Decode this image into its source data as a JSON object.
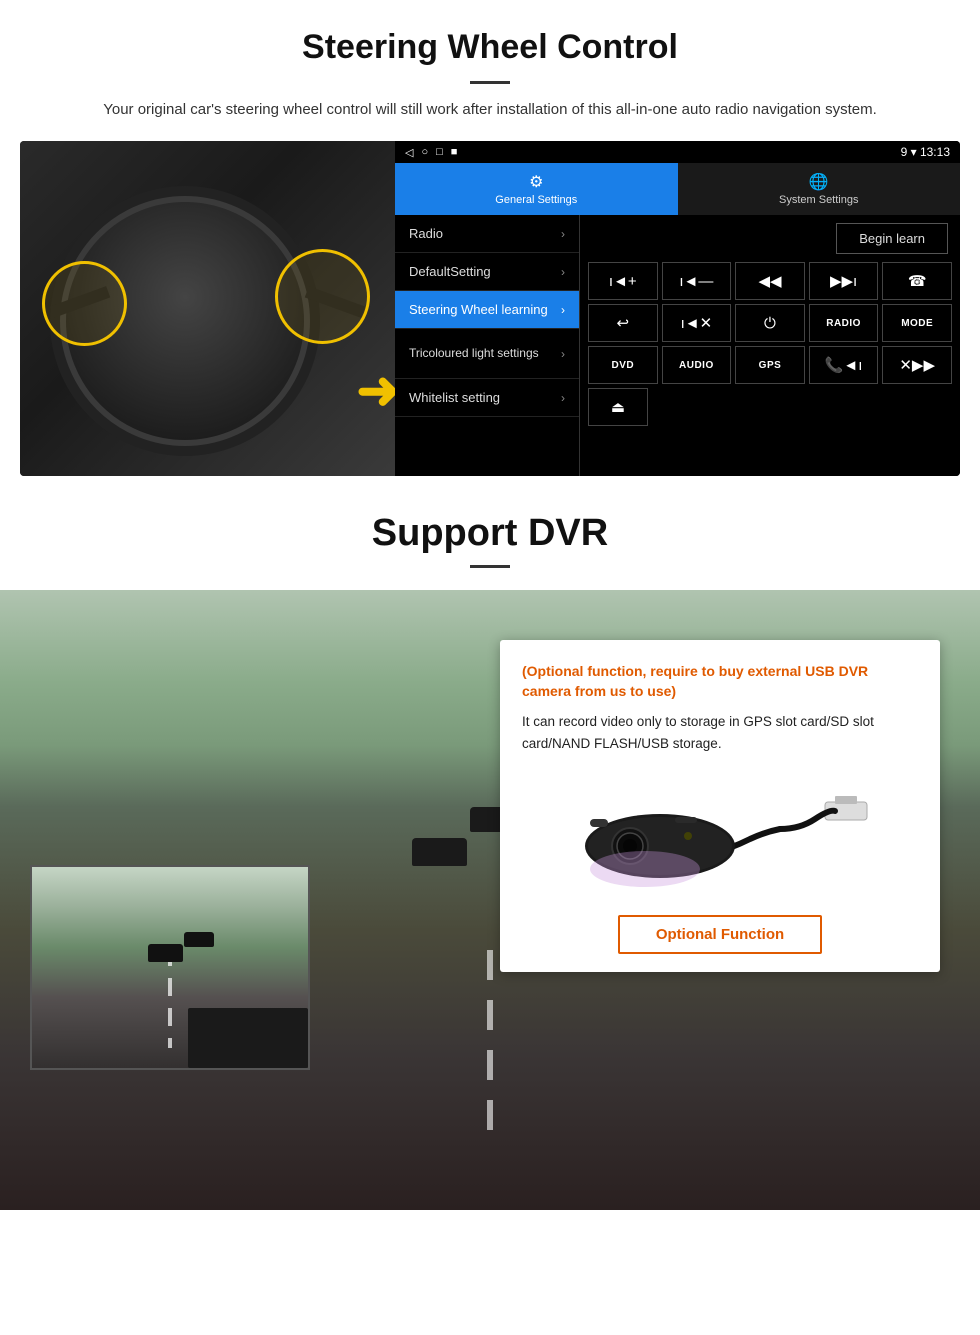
{
  "steering": {
    "title": "Steering Wheel Control",
    "subtitle": "Your original car's steering wheel control will still work after installation of this all-in-one auto radio navigation system.",
    "tabs": {
      "general": {
        "label": "General Settings",
        "icon": "⚙"
      },
      "system": {
        "label": "System Settings",
        "icon": "🌐"
      }
    },
    "menu_items": [
      {
        "label": "Radio",
        "active": false
      },
      {
        "label": "DefaultSetting",
        "active": false
      },
      {
        "label": "Steering Wheel learning",
        "active": true
      },
      {
        "label": "Tricoloured light settings",
        "active": false
      },
      {
        "label": "Whitelist setting",
        "active": false
      }
    ],
    "begin_learn": "Begin learn",
    "statusbar": {
      "left": [
        "◁",
        "○",
        "□",
        "■"
      ],
      "right": "9 ▾ 13:13"
    },
    "controls_row1": [
      "ı◄+",
      "ı◄—",
      "◄◄",
      "▶▶ı",
      "☎"
    ],
    "controls_row2": [
      "↩",
      "ı◄✕",
      "⏻",
      "RADIO",
      "MODE"
    ],
    "controls_row3": [
      "DVD",
      "AUDIO",
      "GPS",
      "📞◄ı",
      "✕▶▶ı"
    ],
    "controls_row4": [
      "⏏"
    ]
  },
  "dvr": {
    "title": "Support DVR",
    "divider": true,
    "optional_note": "(Optional function, require to buy external USB DVR camera from us to use)",
    "description": "It can record video only to storage in GPS slot card/SD slot card/NAND FLASH/USB storage.",
    "optional_btn": "Optional Function"
  }
}
